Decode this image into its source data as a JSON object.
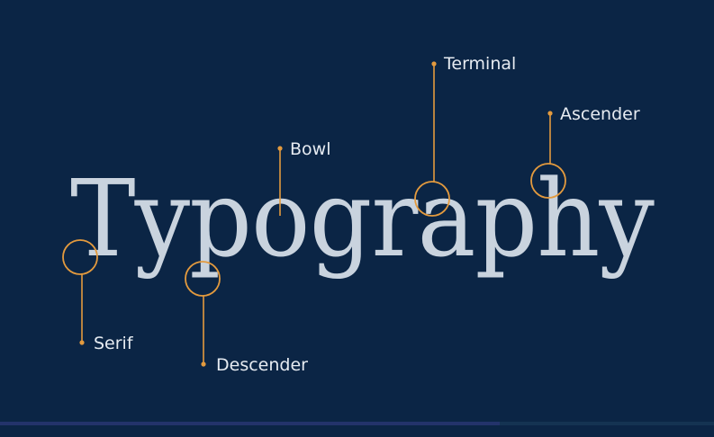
{
  "word": "Typography",
  "colors": {
    "background": "#0b2545",
    "word": "#c9d3de",
    "accent": "#e39a3e",
    "label": "#e6ebf1"
  },
  "annotations": [
    {
      "id": "serif",
      "label": "Serif"
    },
    {
      "id": "descender",
      "label": "Descender"
    },
    {
      "id": "bowl",
      "label": "Bowl"
    },
    {
      "id": "terminal",
      "label": "Terminal"
    },
    {
      "id": "ascender",
      "label": "Ascender"
    }
  ]
}
